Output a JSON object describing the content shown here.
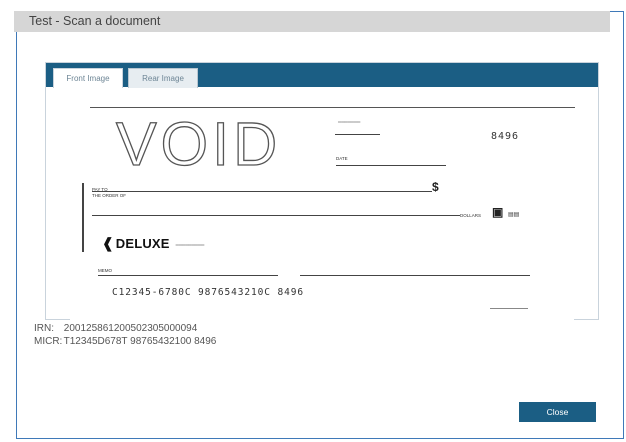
{
  "dialog": {
    "title": "Test - Scan a document"
  },
  "tabs": [
    {
      "label": "Front Image",
      "active": true
    },
    {
      "label": "Rear Image",
      "active": false
    }
  ],
  "check": {
    "void_text": "VOID",
    "check_number": "8496",
    "date_label": "DATE",
    "pay_to_label": "PAY TO",
    "order_label": "THE ORDER OF",
    "dollar_sign": "$",
    "dollars_label": "DOLLARS",
    "bank_name": "DELUXE",
    "memo_label": "MEMO",
    "micr_line": "C12345-6780C 9876543210C   8496"
  },
  "info": {
    "irn_label": "IRN:",
    "irn_value": "200125861200502305000094",
    "micr_label": "MICR:",
    "micr_value": "T12345D678T 98765432100 8496"
  },
  "buttons": {
    "close_label": "Close"
  },
  "colors": {
    "accent": "#1b5e84",
    "border": "#3f79b8",
    "titlebar": "#d6d6d6"
  }
}
